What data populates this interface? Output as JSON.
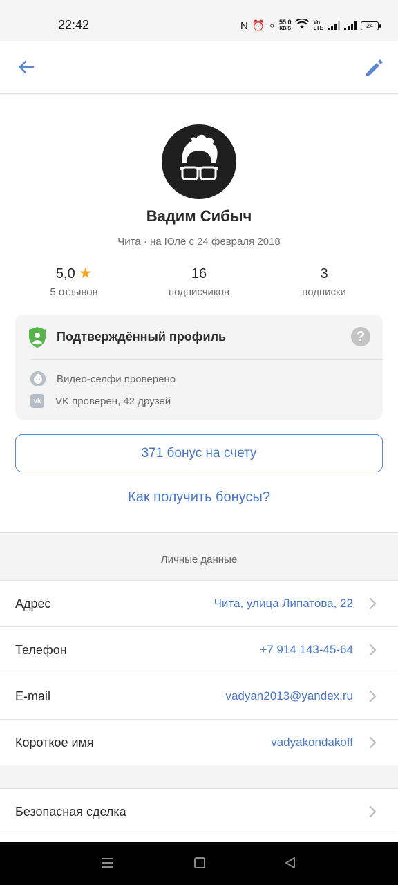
{
  "status_bar": {
    "time": "22:42",
    "speed_value": "55.0",
    "speed_unit": "KB/S",
    "lte_top": "Vo",
    "lte_bottom": "LTE",
    "battery": "24"
  },
  "app_bar": {
    "back_icon": "arrow-left-icon",
    "edit_icon": "pencil-icon",
    "accent_color": "#5b87d3"
  },
  "profile": {
    "name": "Вадим Сибыч",
    "meta": "Чита · на Юле с 24 февраля 2018",
    "rating": {
      "value": "5,0",
      "label": "5 отзывов"
    },
    "followers": {
      "value": "16",
      "label": "подписчиков"
    },
    "following": {
      "value": "3",
      "label": "подписки"
    }
  },
  "verified": {
    "title": "Подтверждённый профиль",
    "help": "?",
    "items": [
      {
        "icon": "face-icon",
        "text": "Видео-селфи проверено"
      },
      {
        "icon": "vk-icon",
        "text": "VK проверен, 42 друзей"
      }
    ]
  },
  "bonus": {
    "button": "371 бонус на счету",
    "link": "Как получить бонусы?"
  },
  "personal": {
    "title": "Личные данные",
    "rows": [
      {
        "label": "Адрес",
        "value": "Чита, улица Липатова, 22"
      },
      {
        "label": "Телефон",
        "value": "+7 914 143-45-64"
      },
      {
        "label": "E-mail",
        "value": "vadyan2013@yandex.ru"
      },
      {
        "label": "Короткое имя",
        "value": "vadyakondakoff"
      }
    ]
  },
  "safe_deal": {
    "label": "Безопасная сделка"
  }
}
